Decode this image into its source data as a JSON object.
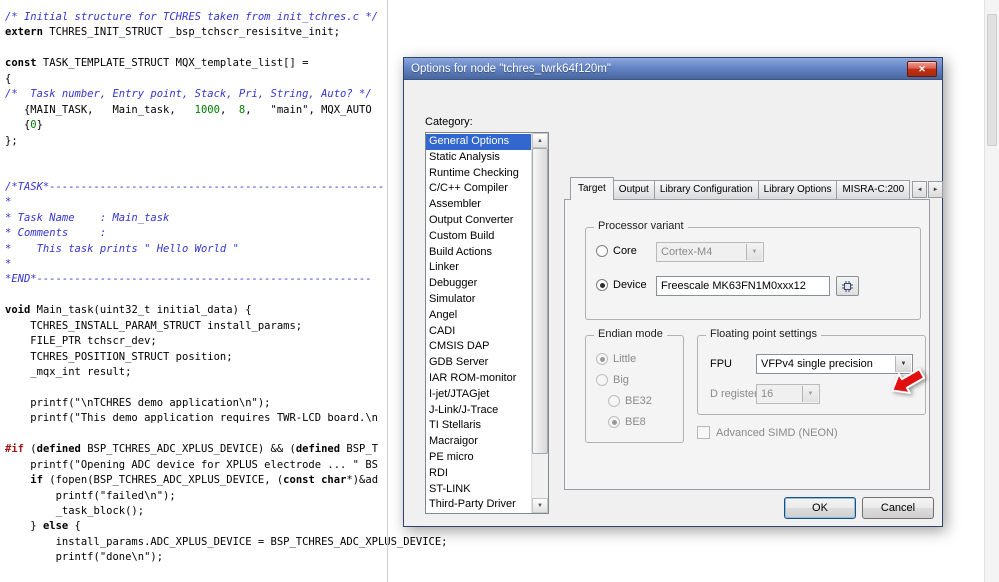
{
  "editor": {
    "lines": [
      [
        [
          "/* Initial structure for TCHRES taken from init_tchres.c */",
          "com"
        ]
      ],
      [
        [
          "extern",
          "kw"
        ],
        [
          " TCHRES_INIT_STRUCT _bsp_tchscr_resisitve_init;",
          "p"
        ]
      ],
      [],
      [
        [
          "const",
          "kw"
        ],
        [
          " TASK_TEMPLATE_STRUCT MQX_template_list[] =",
          "p"
        ]
      ],
      [
        [
          "{",
          "p"
        ]
      ],
      [
        [
          "/*  Task number, Entry point, Stack, Pri, String, Auto? */",
          "com"
        ]
      ],
      [
        [
          "   {MAIN_TASK,   Main_task,   ",
          "p"
        ],
        [
          "1000",
          "num"
        ],
        [
          ",  ",
          "p"
        ],
        [
          "8",
          "num"
        ],
        [
          ",   \"main\", MQX_AUTO",
          "p"
        ]
      ],
      [
        [
          "   {",
          "p"
        ],
        [
          "0",
          "num"
        ],
        [
          "}",
          "p"
        ]
      ],
      [
        [
          "};",
          "p"
        ]
      ],
      [],
      [],
      [
        [
          "/*TASK*-----------------------------------------------------",
          "com"
        ]
      ],
      [
        [
          "*",
          "com"
        ]
      ],
      [
        [
          "* Task Name    : Main_task",
          "com"
        ]
      ],
      [
        [
          "* Comments     :",
          "com"
        ]
      ],
      [
        [
          "*    This task prints \" Hello World \"",
          "com"
        ]
      ],
      [
        [
          "*",
          "com"
        ]
      ],
      [
        [
          "*END*-----------------------------------------------------",
          "com"
        ]
      ],
      [],
      [
        [
          "void",
          "kw"
        ],
        [
          " Main_task(uint32_t initial_data) {",
          "p"
        ]
      ],
      [
        [
          "    TCHRES_INSTALL_PARAM_STRUCT install_params;",
          "p"
        ]
      ],
      [
        [
          "    FILE_PTR tchscr_dev;",
          "p"
        ]
      ],
      [
        [
          "    TCHRES_POSITION_STRUCT position;",
          "p"
        ]
      ],
      [
        [
          "    _mqx_int result;",
          "p"
        ]
      ],
      [],
      [
        [
          "    printf(\"\\nTCHRES demo application\\n\");",
          "p"
        ]
      ],
      [
        [
          "    printf(\"This demo application requires TWR-LCD board.\\n",
          "p"
        ]
      ],
      [],
      [
        [
          "#if",
          "pre"
        ],
        [
          " (",
          "p"
        ],
        [
          "defined",
          "kw"
        ],
        [
          " BSP_TCHRES_ADC_XPLUS_DEVICE) && (",
          "p"
        ],
        [
          "defined",
          "kw"
        ],
        [
          " BSP_T",
          "p"
        ]
      ],
      [
        [
          "    printf(\"Opening ADC device for XPLUS electrode ... \" BS",
          "p"
        ]
      ],
      [
        [
          "    ",
          "p"
        ],
        [
          "if",
          "kw"
        ],
        [
          " (fopen(BSP_TCHRES_ADC_XPLUS_DEVICE, (",
          "p"
        ],
        [
          "const",
          "kw"
        ],
        [
          " ",
          "p"
        ],
        [
          "char",
          "kw"
        ],
        [
          "*)&ad",
          "p"
        ]
      ],
      [
        [
          "        printf(\"failed\\n\");",
          "p"
        ]
      ],
      [
        [
          "        _task_block();",
          "p"
        ]
      ],
      [
        [
          "    } ",
          "p"
        ],
        [
          "else",
          "kw"
        ],
        [
          " {",
          "p"
        ]
      ],
      [
        [
          "        install_params.ADC_XPLUS_DEVICE = BSP_TCHRES_ADC_XPLUS_DEVICE;",
          "p"
        ]
      ],
      [
        [
          "        printf(\"done\\n\");",
          "p"
        ]
      ]
    ]
  },
  "dialog": {
    "title": "Options for node \"tchres_twrk64f120m\"",
    "close_glyph": "✕",
    "category_label": "Category:",
    "selected_category": "General Options",
    "categories": [
      "General Options",
      "Static Analysis",
      "Runtime Checking",
      "C/C++ Compiler",
      "Assembler",
      "Output Converter",
      "Custom Build",
      "Build Actions",
      "Linker",
      "Debugger",
      "Simulator",
      "Angel",
      "CADI",
      "CMSIS DAP",
      "GDB Server",
      "IAR ROM-monitor",
      "I-jet/JTAGjet",
      "J-Link/J-Trace",
      "TI Stellaris",
      "Macraigor",
      "PE micro",
      "RDI",
      "ST-LINK",
      "Third-Party Driver"
    ],
    "tabs": [
      "Target",
      "Output",
      "Library Configuration",
      "Library Options",
      "MISRA-C:200"
    ],
    "active_tab": "Target",
    "tab_scroll_left": "◄",
    "tab_scroll_right": "►",
    "groups": {
      "processor_variant": {
        "label": "Processor variant",
        "core_label": "Core",
        "core_value": "Cortex-M4",
        "device_label": "Device",
        "device_value": "Freescale MK63FN1M0xxx12"
      },
      "endian_mode": {
        "label": "Endian mode",
        "options": [
          {
            "label": "Little",
            "selected": true,
            "indent": false
          },
          {
            "label": "Big",
            "selected": false,
            "indent": false
          },
          {
            "label": "BE32",
            "selected": false,
            "indent": true
          },
          {
            "label": "BE8",
            "selected": true,
            "indent": true
          }
        ]
      },
      "fp_settings": {
        "label": "Floating point settings",
        "fpu_label": "FPU",
        "fpu_value": "VFPv4 single precision",
        "dreg_label": "D registers",
        "dreg_value": "16",
        "neon_label": "Advanced SIMD (NEON)"
      }
    },
    "ok_label": "OK",
    "cancel_label": "Cancel"
  },
  "colors": {
    "selection_blue": "#3167ce",
    "title_gradient_top": "#8ea7dc",
    "title_gradient_bottom": "#48669e",
    "annotation_arrow_red": "#e01010",
    "comment_blue": "#3535cf",
    "number_green": "#007d00",
    "preprocessor_maroon": "#9b1b1b"
  }
}
